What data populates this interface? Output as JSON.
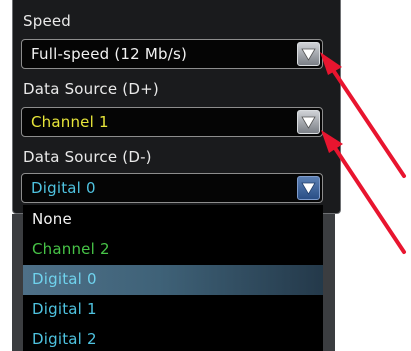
{
  "speed": {
    "label": "Speed",
    "value": "Full-speed (12 Mb/s)",
    "value_color": "#f2f2f2"
  },
  "data_source_dplus": {
    "label": "Data Source (D+)",
    "value": "Channel 1",
    "value_color": "#e8e63a"
  },
  "data_source_dminus": {
    "label": "Data Source (D-)",
    "value": "Digital 0",
    "value_color": "#4fc3e0",
    "options": [
      {
        "label": "None",
        "color": "#f2f2f2"
      },
      {
        "label": "Channel 2",
        "color": "#47c347"
      },
      {
        "label": "Digital 0",
        "color": "#6fd3ee",
        "selected": true
      },
      {
        "label": "Digital 1",
        "color": "#4fc3e0"
      },
      {
        "label": "Digital 2",
        "color": "#4fc3e0"
      }
    ]
  },
  "icons": {
    "dropdown": "chevron-down-icon",
    "annotation": "red-arrow-annotation"
  },
  "colors": {
    "panel_bg": "#1a1b1d",
    "annotation_red": "#e8152f"
  }
}
